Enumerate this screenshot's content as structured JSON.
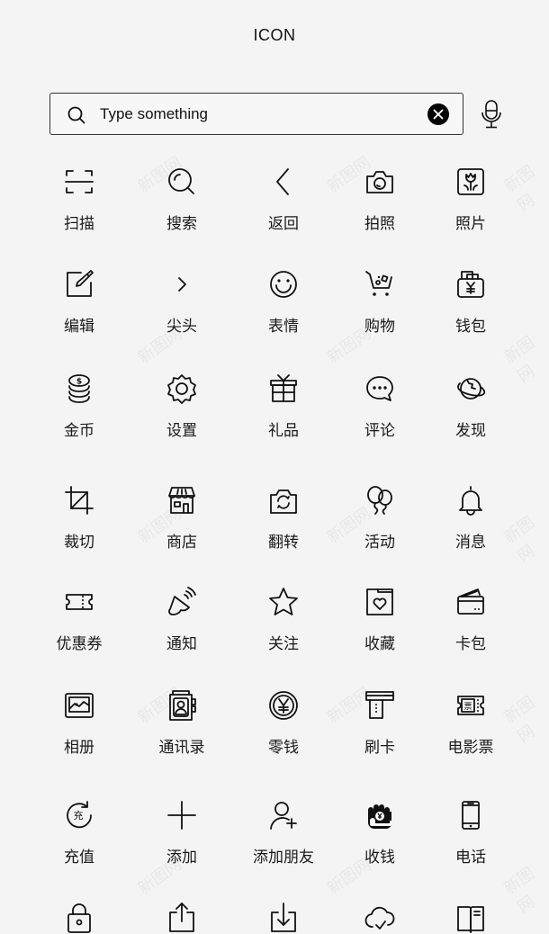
{
  "header": {
    "title": "ICON"
  },
  "search": {
    "value": "",
    "placeholder": "Type something",
    "search_icon": "search-icon",
    "clear_icon": "clear-circle-icon",
    "voice_icon": "microphone-icon"
  },
  "watermark": "新图网",
  "icons": [
    {
      "label": "扫描",
      "icon": "scan-icon"
    },
    {
      "label": "搜索",
      "icon": "search-icon"
    },
    {
      "label": "返回",
      "icon": "chevron-left-icon"
    },
    {
      "label": "拍照",
      "icon": "camera-icon"
    },
    {
      "label": "照片",
      "icon": "photo-icon"
    },
    {
      "label": "编辑",
      "icon": "edit-icon"
    },
    {
      "label": "尖头",
      "icon": "chevron-right-icon"
    },
    {
      "label": "表情",
      "icon": "smile-icon"
    },
    {
      "label": "购物",
      "icon": "cart-icon"
    },
    {
      "label": "钱包",
      "icon": "wallet-icon"
    },
    {
      "label": "金币",
      "icon": "coins-icon"
    },
    {
      "label": "设置",
      "icon": "gear-icon"
    },
    {
      "label": "礼品",
      "icon": "gift-icon"
    },
    {
      "label": "评论",
      "icon": "comment-icon"
    },
    {
      "label": "发现",
      "icon": "planet-icon"
    },
    {
      "label": "裁切",
      "icon": "crop-icon"
    },
    {
      "label": "商店",
      "icon": "store-icon"
    },
    {
      "label": "翻转",
      "icon": "flip-camera-icon"
    },
    {
      "label": "活动",
      "icon": "balloons-icon"
    },
    {
      "label": "消息",
      "icon": "bell-icon"
    },
    {
      "label": "优惠券",
      "icon": "coupon-icon"
    },
    {
      "label": "通知",
      "icon": "notification-icon"
    },
    {
      "label": "关注",
      "icon": "star-icon"
    },
    {
      "label": "收藏",
      "icon": "favorite-folder-icon"
    },
    {
      "label": "卡包",
      "icon": "card-wallet-icon"
    },
    {
      "label": "相册",
      "icon": "album-icon"
    },
    {
      "label": "通讯录",
      "icon": "contacts-icon"
    },
    {
      "label": "零钱",
      "icon": "yuan-coin-icon"
    },
    {
      "label": "刷卡",
      "icon": "card-swipe-icon"
    },
    {
      "label": "电影票",
      "icon": "movie-ticket-icon"
    },
    {
      "label": "充值",
      "icon": "recharge-icon"
    },
    {
      "label": "添加",
      "icon": "plus-icon"
    },
    {
      "label": "添加朋友",
      "icon": "add-friend-icon"
    },
    {
      "label": "收钱",
      "icon": "receive-money-icon"
    },
    {
      "label": "电话",
      "icon": "phone-icon"
    },
    {
      "label": "",
      "icon": "lock-icon"
    },
    {
      "label": "",
      "icon": "upload-icon"
    },
    {
      "label": "",
      "icon": "download-icon"
    },
    {
      "label": "",
      "icon": "cloud-icon"
    },
    {
      "label": "",
      "icon": "book-icon"
    }
  ]
}
